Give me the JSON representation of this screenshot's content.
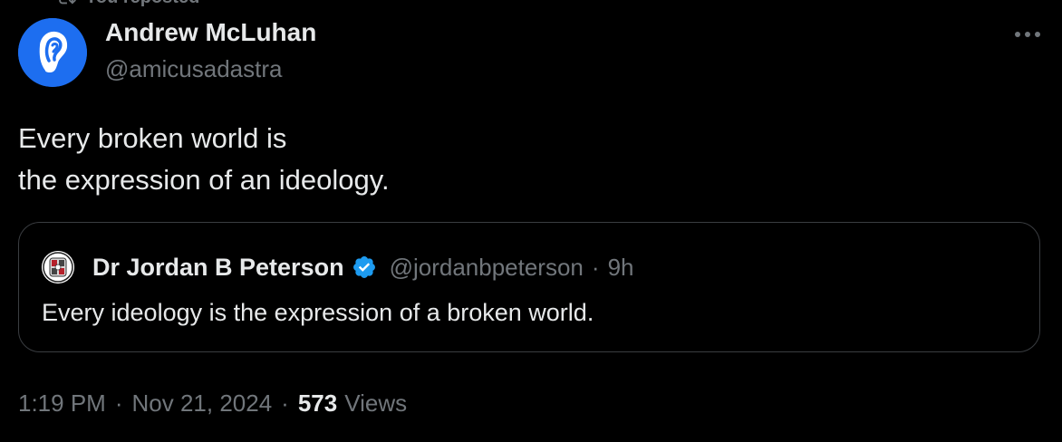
{
  "repost": {
    "label": "You reposted"
  },
  "author": {
    "name": "Andrew McLuhan",
    "handle": "@amicusadastra",
    "avatar_color": "#1d6ef0"
  },
  "post": {
    "lines": [
      "Every broken world is",
      "the expression of an ideology."
    ]
  },
  "quote": {
    "name": "Dr Jordan B Peterson",
    "verified": true,
    "verified_color": "#1d9bf0",
    "handle": "@jordanbpeterson",
    "separator": "·",
    "time": "9h",
    "text": "Every ideology is the expression of a broken world."
  },
  "meta": {
    "time": "1:19 PM",
    "separator": "·",
    "date": "Nov 21, 2024",
    "views_count": "573",
    "views_label": "Views"
  },
  "icons": {
    "more": "more-horizontal-icon",
    "repost": "repost-icon",
    "verified": "verified-badge-icon"
  },
  "colors": {
    "background": "#000000",
    "primary_text": "#e7e9ea",
    "secondary_text": "#71767b",
    "border": "#3a3d41"
  }
}
